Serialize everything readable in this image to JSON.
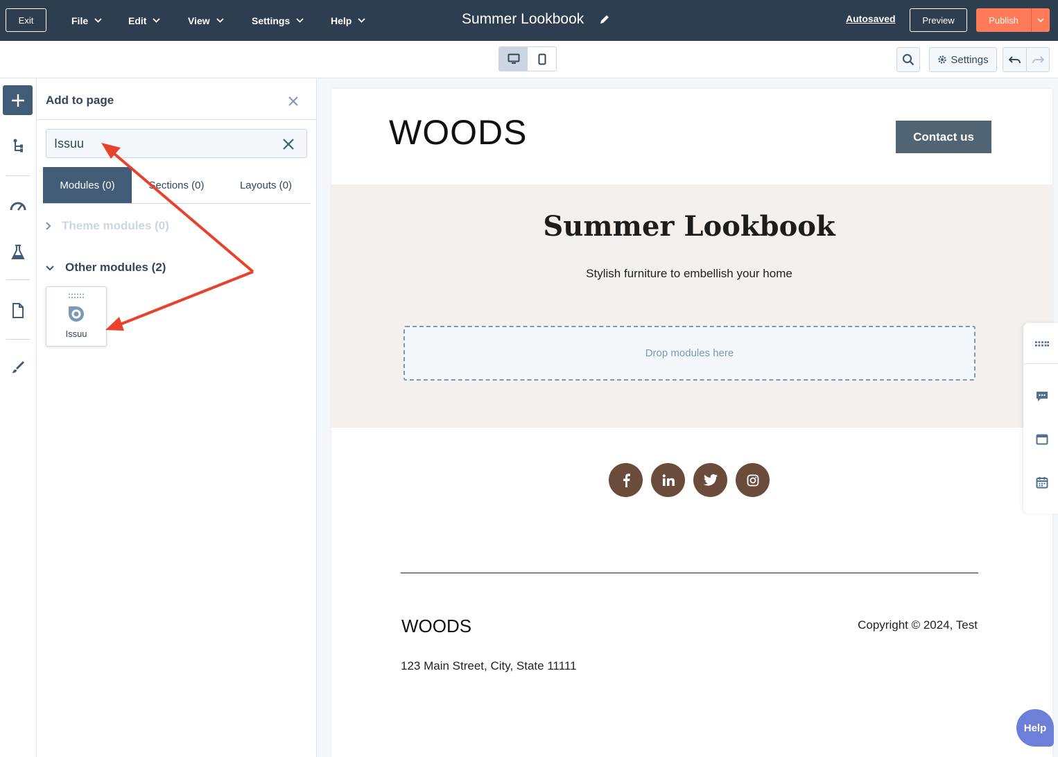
{
  "topbar": {
    "exit_label": "Exit",
    "menus": [
      "File",
      "Edit",
      "View",
      "Settings",
      "Help"
    ],
    "page_title": "Summer Lookbook",
    "autosaved_label": "Autosaved",
    "preview_label": "Preview",
    "publish_label": "Publish"
  },
  "toolbar": {
    "settings_label": "Settings",
    "active_device": "desktop"
  },
  "add_panel": {
    "title": "Add to page",
    "search_value": "Issuu",
    "tabs": [
      "Modules (0)",
      "Sections (0)",
      "Layouts (0)"
    ],
    "active_tab": "Modules (0)",
    "groups": {
      "theme": "Theme modules (0)",
      "other": "Other modules (2)"
    },
    "module_card": {
      "label": "Issuu",
      "icon": "issuu-icon"
    }
  },
  "page": {
    "header_logo": "WOODS",
    "contact_label": "Contact us",
    "hero_title": "Summer Lookbook",
    "hero_subtitle": "Stylish furniture to embellish your home",
    "dropzone_text": "Drop modules here",
    "social_icons": [
      "facebook-icon",
      "linkedin-icon",
      "twitter-icon",
      "instagram-icon"
    ],
    "footer_logo": "WOODS",
    "copyright": "Copyright © 2024, Test",
    "address": "123 Main Street, City, State 11111"
  },
  "help_label": "Help",
  "colors": {
    "topbar_bg": "#2d3e50",
    "publish": "#ff7a59",
    "panel_accent": "#425b76",
    "social_bg": "#6b4c3b",
    "hero_bg": "#f3f0ed",
    "annotation_arrow": "#e8412c",
    "help_bg": "#6d7fd8"
  }
}
